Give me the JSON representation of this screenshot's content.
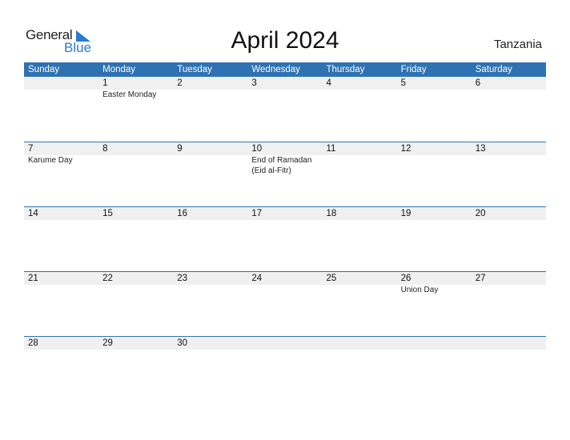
{
  "logo": {
    "general": "General",
    "blue": "Blue",
    "brand_color": "#2a7bd0"
  },
  "title": "April 2024",
  "country": "Tanzania",
  "header_color": "#2e72b3",
  "weekdays": [
    "Sunday",
    "Monday",
    "Tuesday",
    "Wednesday",
    "Thursday",
    "Friday",
    "Saturday"
  ],
  "weeks": [
    [
      {
        "day": "",
        "event": ""
      },
      {
        "day": "1",
        "event": "Easter Monday"
      },
      {
        "day": "2",
        "event": ""
      },
      {
        "day": "3",
        "event": ""
      },
      {
        "day": "4",
        "event": ""
      },
      {
        "day": "5",
        "event": ""
      },
      {
        "day": "6",
        "event": ""
      }
    ],
    [
      {
        "day": "7",
        "event": "Karume Day"
      },
      {
        "day": "8",
        "event": ""
      },
      {
        "day": "9",
        "event": ""
      },
      {
        "day": "10",
        "event": "End of Ramadan\n(Eid al-Fitr)"
      },
      {
        "day": "11",
        "event": ""
      },
      {
        "day": "12",
        "event": ""
      },
      {
        "day": "13",
        "event": ""
      }
    ],
    [
      {
        "day": "14",
        "event": ""
      },
      {
        "day": "15",
        "event": ""
      },
      {
        "day": "16",
        "event": ""
      },
      {
        "day": "17",
        "event": ""
      },
      {
        "day": "18",
        "event": ""
      },
      {
        "day": "19",
        "event": ""
      },
      {
        "day": "20",
        "event": ""
      }
    ],
    [
      {
        "day": "21",
        "event": ""
      },
      {
        "day": "22",
        "event": ""
      },
      {
        "day": "23",
        "event": ""
      },
      {
        "day": "24",
        "event": ""
      },
      {
        "day": "25",
        "event": ""
      },
      {
        "day": "26",
        "event": "Union Day"
      },
      {
        "day": "27",
        "event": ""
      }
    ],
    [
      {
        "day": "28",
        "event": ""
      },
      {
        "day": "29",
        "event": ""
      },
      {
        "day": "30",
        "event": ""
      },
      {
        "day": "",
        "event": ""
      },
      {
        "day": "",
        "event": ""
      },
      {
        "day": "",
        "event": ""
      },
      {
        "day": "",
        "event": ""
      }
    ]
  ]
}
